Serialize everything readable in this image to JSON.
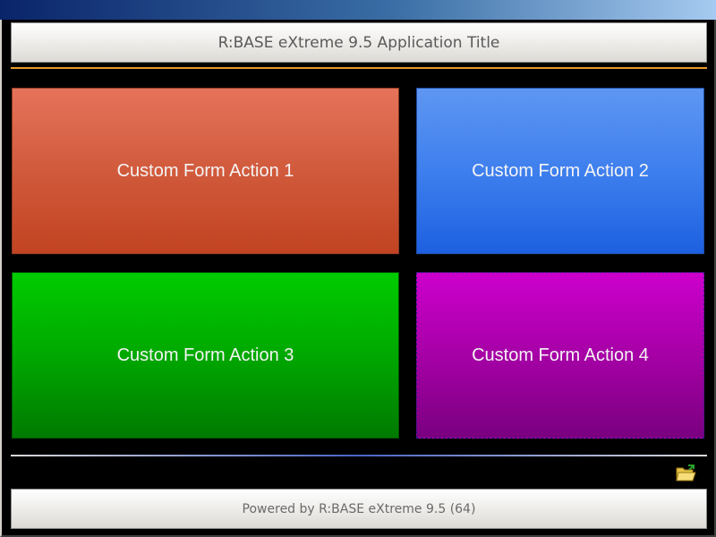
{
  "header": {
    "title": "R:BASE eXtreme 9.5 Application Title"
  },
  "tiles": [
    {
      "label": "Custom Form Action 1",
      "color": "#d15a3c"
    },
    {
      "label": "Custom Form Action 2",
      "color": "#3e7fee"
    },
    {
      "label": "Custom Form Action 3",
      "color": "#00a800"
    },
    {
      "label": "Custom Form Action 4",
      "color": "#a600a6"
    }
  ],
  "toolbar": {
    "open_icon": "folder-open-icon"
  },
  "footer": {
    "text": "Powered by R:BASE eXtreme 9.5 (64)"
  },
  "colors": {
    "accent_line": "#e89a2a",
    "background": "#000000"
  }
}
